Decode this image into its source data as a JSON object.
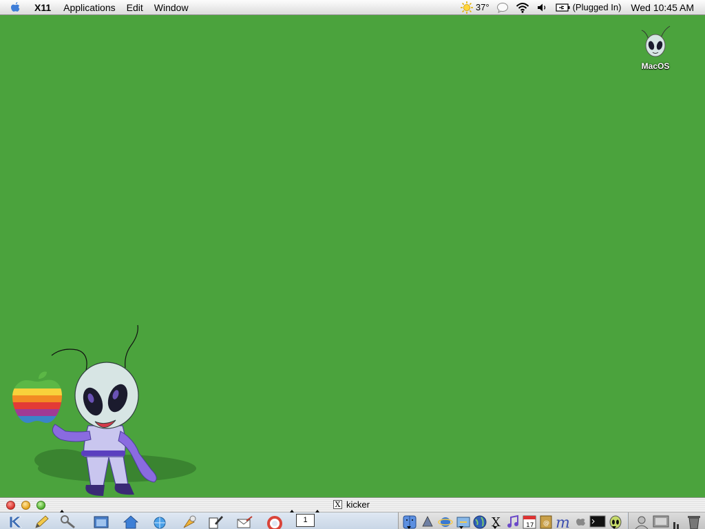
{
  "menubar": {
    "app_name": "X11",
    "menus": [
      "Applications",
      "Edit",
      "Window"
    ],
    "weather_temp": "37°",
    "battery_status": "(Plugged In)",
    "clock": "Wed 10:45 AM"
  },
  "desktop": {
    "background_color": "#4ba33d",
    "icons": [
      {
        "label": "MacOS",
        "icon": "alien-icon"
      }
    ]
  },
  "kicker": {
    "title": "kicker",
    "title_badge": "X",
    "pager_desktop": "1"
  }
}
